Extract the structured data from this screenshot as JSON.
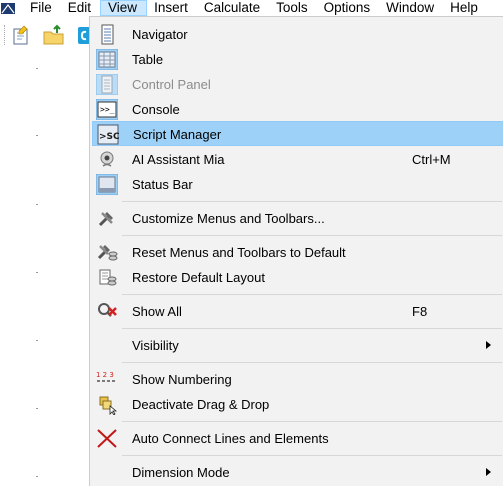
{
  "menubar": {
    "items": [
      {
        "label": "File"
      },
      {
        "label": "Edit"
      },
      {
        "label": "View"
      },
      {
        "label": "Insert"
      },
      {
        "label": "Calculate"
      },
      {
        "label": "Tools"
      },
      {
        "label": "Options"
      },
      {
        "label": "Window"
      },
      {
        "label": "Help"
      }
    ],
    "active_item": "View"
  },
  "view_menu": {
    "items": [
      {
        "label": "Navigator",
        "icon": "navigator-icon",
        "enabled": true
      },
      {
        "label": "Table",
        "icon": "table-icon",
        "enabled": true
      },
      {
        "label": "Control Panel",
        "icon": "control-panel-icon",
        "enabled": false
      },
      {
        "label": "Console",
        "icon": "console-icon",
        "enabled": true
      },
      {
        "label": "Script Manager",
        "icon": "script-manager-icon",
        "enabled": true,
        "highlighted": true
      },
      {
        "label": "AI Assistant Mia",
        "icon": "ai-assistant-icon",
        "shortcut": "Ctrl+M",
        "enabled": true
      },
      {
        "label": "Status Bar",
        "icon": "status-bar-icon",
        "enabled": true
      },
      {
        "label": "Customize Menus and Toolbars...",
        "icon": "tools-icon",
        "enabled": true
      },
      {
        "label": "Reset Menus and Toolbars to Default",
        "icon": "reset-tools-icon",
        "enabled": true
      },
      {
        "label": "Restore Default Layout",
        "icon": "restore-layout-icon",
        "enabled": true
      },
      {
        "label": "Show All",
        "icon": "show-all-icon",
        "shortcut": "F8",
        "enabled": true
      },
      {
        "label": "Visibility",
        "enabled": true,
        "submenu": true
      },
      {
        "label": "Show Numbering",
        "icon": "numbering-icon",
        "enabled": true
      },
      {
        "label": "Deactivate Drag & Drop",
        "icon": "drag-drop-icon",
        "enabled": true
      },
      {
        "label": "Auto Connect Lines and Elements",
        "icon": "auto-connect-icon",
        "enabled": true
      },
      {
        "label": "Dimension Mode",
        "enabled": true,
        "submenu": true
      }
    ]
  },
  "colors": {
    "highlight": "#9ed1f7",
    "menu_background": "#f2f2f2",
    "active_menubar": "#cce8ff"
  }
}
